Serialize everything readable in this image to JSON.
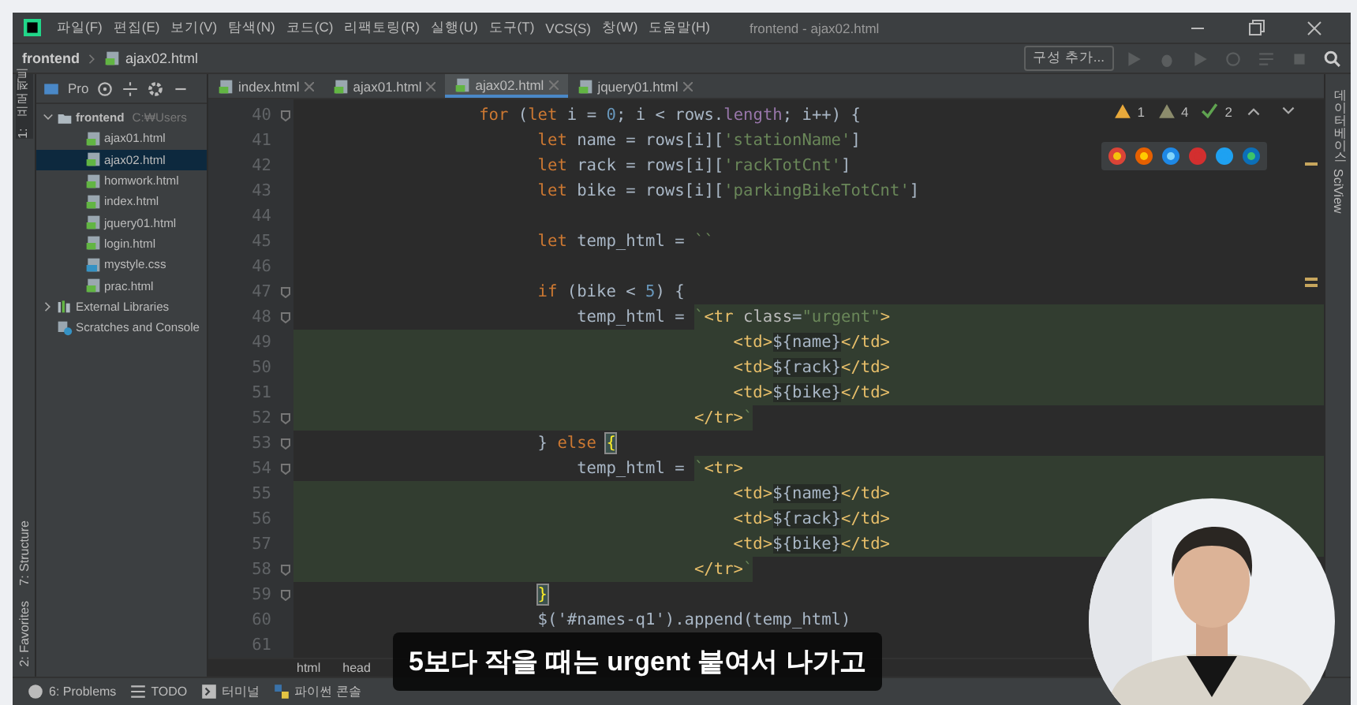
{
  "window": {
    "title": "frontend - ajax02.html"
  },
  "menu": [
    {
      "label": "파일(F)"
    },
    {
      "label": "편집(E)"
    },
    {
      "label": "보기(V)"
    },
    {
      "label": "탐색(N)"
    },
    {
      "label": "코드(C)"
    },
    {
      "label": "리팩토링(R)"
    },
    {
      "label": "실행(U)"
    },
    {
      "label": "도구(T)"
    },
    {
      "label": "VCS(S)"
    },
    {
      "label": "창(W)"
    },
    {
      "label": "도움말(H)"
    }
  ],
  "breadcrumb": [
    "frontend",
    "ajax02.html"
  ],
  "run_config": {
    "label": "구성 추가..."
  },
  "left_strip": {
    "project": "1: 프로젝트",
    "structure": "7: Structure",
    "favorites": "2: Favorites"
  },
  "project_panel": {
    "label": "Pro"
  },
  "tabs": [
    {
      "label": "index.html",
      "selected": false
    },
    {
      "label": "ajax01.html",
      "selected": false
    },
    {
      "label": "ajax02.html",
      "selected": true
    },
    {
      "label": "jquery01.html",
      "selected": false
    }
  ],
  "tree": [
    {
      "label": "frontend",
      "path": "C:₩Users",
      "kind": "folder",
      "expanded": true,
      "selected": false,
      "children": [
        {
          "label": "ajax01.html",
          "kind": "html",
          "selected": false
        },
        {
          "label": "ajax02.html",
          "kind": "html",
          "selected": true
        },
        {
          "label": "homwork.html",
          "kind": "html",
          "selected": false
        },
        {
          "label": "index.html",
          "kind": "html",
          "selected": false
        },
        {
          "label": "jquery01.html",
          "kind": "html",
          "selected": false
        },
        {
          "label": "login.html",
          "kind": "html",
          "selected": false
        },
        {
          "label": "mystyle.css",
          "kind": "css",
          "selected": false
        },
        {
          "label": "prac.html",
          "kind": "html",
          "selected": false
        }
      ]
    },
    {
      "label": "External Libraries",
      "kind": "library",
      "expanded": false,
      "selected": false
    },
    {
      "label": "Scratches and Console",
      "kind": "scratches",
      "selected": false
    }
  ],
  "inspections": [
    {
      "kind": "warning",
      "count": "1"
    },
    {
      "kind": "weak_warning",
      "count": "4"
    },
    {
      "kind": "typo",
      "count": "2"
    }
  ],
  "right_strip": [
    "데이터베이스",
    "SciView"
  ],
  "lines": [
    {
      "n": "40",
      "kind": "plain",
      "fold": true,
      "code": [
        {
          "kind": "keyword",
          "text": "                  for"
        },
        {
          "kind": "plain",
          "text": " ("
        },
        {
          "kind": "keyword",
          "text": "let"
        },
        {
          "kind": "plain",
          "text": " i = "
        },
        {
          "kind": "number",
          "text": "0"
        },
        {
          "kind": "plain",
          "text": "; i < rows."
        },
        {
          "kind": "field",
          "text": "length"
        },
        {
          "kind": "plain",
          "text": "; i++) {"
        }
      ]
    },
    {
      "n": "41",
      "kind": "plain",
      "fold": false,
      "code": [
        {
          "kind": "keyword",
          "text": "                        let"
        },
        {
          "kind": "plain",
          "text": " name = rows[i]["
        },
        {
          "kind": "string",
          "text": "'stationName'"
        },
        {
          "kind": "plain",
          "text": "]"
        }
      ]
    },
    {
      "n": "42",
      "kind": "plain",
      "fold": false,
      "code": [
        {
          "kind": "keyword",
          "text": "                        let"
        },
        {
          "kind": "plain",
          "text": " rack = rows[i]["
        },
        {
          "kind": "string",
          "text": "'rackTotCnt'"
        },
        {
          "kind": "plain",
          "text": "]"
        }
      ]
    },
    {
      "n": "43",
      "kind": "plain",
      "fold": false,
      "code": [
        {
          "kind": "keyword",
          "text": "                        let"
        },
        {
          "kind": "plain",
          "text": " bike = rows[i]["
        },
        {
          "kind": "string",
          "text": "'parkingBikeTotCnt'"
        },
        {
          "kind": "plain",
          "text": "]"
        }
      ]
    },
    {
      "n": "44",
      "kind": "plain",
      "fold": false
    },
    {
      "n": "45",
      "kind": "plain",
      "fold": false,
      "code": [
        {
          "kind": "keyword",
          "text": "                        let"
        },
        {
          "kind": "plain",
          "text": " temp_html = "
        },
        {
          "kind": "string",
          "text": "``"
        }
      ]
    },
    {
      "n": "46",
      "kind": "plain",
      "fold": false
    },
    {
      "n": "47",
      "kind": "plain",
      "fold": true,
      "code": [
        {
          "kind": "keyword",
          "text": "                        if"
        },
        {
          "kind": "plain",
          "text": " (bike < "
        },
        {
          "kind": "number",
          "text": "5"
        },
        {
          "kind": "plain",
          "text": ") {"
        }
      ]
    },
    {
      "n": "48",
      "kind": "start",
      "fold": true,
      "code": [
        {
          "kind": "plain",
          "text": "                            temp_html = "
        },
        {
          "kind": "string",
          "text": "`"
        },
        {
          "kind": "tag",
          "text": "<tr "
        },
        {
          "kind": "attr",
          "text": "class"
        },
        {
          "kind": "plain",
          "text": "="
        },
        {
          "kind": "string",
          "text": "\"urgent\""
        },
        {
          "kind": "tag",
          "text": ">"
        }
      ]
    },
    {
      "n": "49",
      "kind": "inner",
      "fold": false,
      "code": [
        {
          "kind": "tag",
          "text": "                                            <td>"
        },
        {
          "kind": "interp",
          "text": "${name}"
        },
        {
          "kind": "tag",
          "text": "</td>"
        }
      ]
    },
    {
      "n": "50",
      "kind": "inner",
      "fold": false,
      "code": [
        {
          "kind": "tag",
          "text": "                                            <td>"
        },
        {
          "kind": "interp",
          "text": "${rack}"
        },
        {
          "kind": "tag",
          "text": "</td>"
        }
      ]
    },
    {
      "n": "51",
      "kind": "inner",
      "fold": false,
      "code": [
        {
          "kind": "tag",
          "text": "                                            <td>"
        },
        {
          "kind": "interp",
          "text": "${bike}"
        },
        {
          "kind": "tag",
          "text": "</td>"
        }
      ]
    },
    {
      "n": "52",
      "kind": "end",
      "fold": true,
      "code": [
        {
          "kind": "tag",
          "text": "                                        </tr>"
        },
        {
          "kind": "string",
          "text": "`"
        }
      ]
    },
    {
      "n": "53",
      "kind": "plain",
      "fold": true,
      "code": [
        {
          "kind": "plain",
          "text": "                        } "
        },
        {
          "kind": "keyword",
          "text": "else"
        },
        {
          "kind": "brace",
          "text": " {"
        }
      ]
    },
    {
      "n": "54",
      "kind": "start",
      "fold": true,
      "code": [
        {
          "kind": "plain",
          "text": "                            temp_html = "
        },
        {
          "kind": "string",
          "text": "`"
        },
        {
          "kind": "tag",
          "text": "<tr>"
        }
      ]
    },
    {
      "n": "55",
      "kind": "inner",
      "fold": false,
      "code": [
        {
          "kind": "tag",
          "text": "                                            <td>"
        },
        {
          "kind": "interp",
          "text": "${name}"
        },
        {
          "kind": "tag",
          "text": "</td>"
        }
      ]
    },
    {
      "n": "56",
      "kind": "inner",
      "fold": false,
      "code": [
        {
          "kind": "tag",
          "text": "                                            <td>"
        },
        {
          "kind": "interp",
          "text": "${rack}"
        },
        {
          "kind": "tag",
          "text": "</td>"
        }
      ]
    },
    {
      "n": "57",
      "kind": "inner",
      "fold": false,
      "code": [
        {
          "kind": "tag",
          "text": "                                            <td>"
        },
        {
          "kind": "interp",
          "text": "${bike}"
        },
        {
          "kind": "tag",
          "text": "</td>"
        }
      ]
    },
    {
      "n": "58",
      "kind": "end",
      "fold": true,
      "code": [
        {
          "kind": "tag",
          "text": "                                        </tr>"
        },
        {
          "kind": "string",
          "text": "`"
        }
      ]
    },
    {
      "n": "59",
      "kind": "plain",
      "fold": true,
      "code": [
        {
          "kind": "brace",
          "text": "                        }"
        }
      ]
    },
    {
      "n": "60",
      "kind": "plain",
      "fold": false,
      "code": [
        {
          "kind": "plain",
          "text": "                        $('#names-q1').append(temp_html)"
        }
      ]
    },
    {
      "n": "61",
      "kind": "plain",
      "fold": false
    }
  ],
  "editor_breadcrumb": [
    "html",
    "head"
  ],
  "status_bar": [
    {
      "kind": "problems",
      "label": "6: Problems"
    },
    {
      "kind": "todo",
      "label": "TODO"
    },
    {
      "kind": "terminal",
      "label": "터미널"
    },
    {
      "kind": "console",
      "label": "파이썬 콘솔"
    }
  ],
  "subtitle": "5보다 작을 때는 urgent 붙여서 나가고",
  "webcam": {
    "kind": "picture"
  }
}
